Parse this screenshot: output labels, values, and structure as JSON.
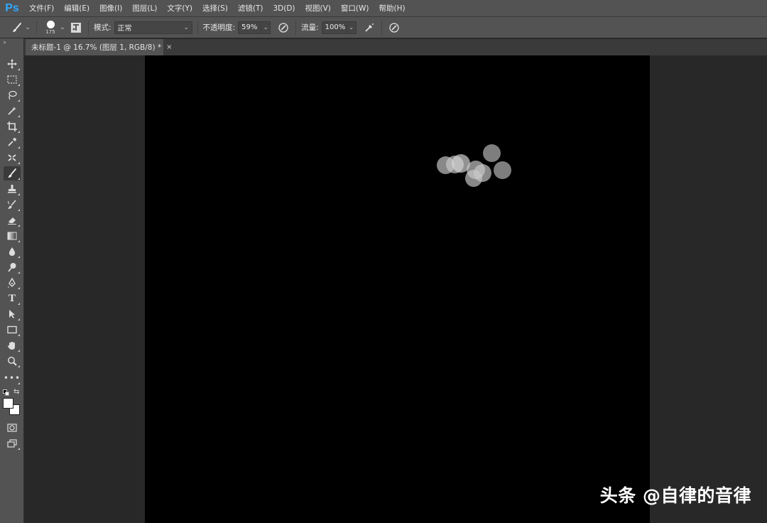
{
  "app": {
    "logo": "Ps"
  },
  "menu": {
    "items": [
      "文件(F)",
      "编辑(E)",
      "图像(I)",
      "图层(L)",
      "文字(Y)",
      "选择(S)",
      "滤镜(T)",
      "3D(D)",
      "视图(V)",
      "窗口(W)",
      "帮助(H)"
    ]
  },
  "options": {
    "brush_size": "175",
    "mode_label": "模式:",
    "mode_value": "正常",
    "opacity_label": "不透明度:",
    "opacity_value": "59%",
    "flow_label": "流量:",
    "flow_value": "100%"
  },
  "document": {
    "tab_title": "未标题-1 @ 16.7% (图层 1, RGB/8) *",
    "close_glyph": "×"
  },
  "tools": [
    "move-tool",
    "marquee-tool",
    "lasso-tool",
    "magic-wand-tool",
    "crop-tool",
    "eyedropper-tool",
    "healing-tool",
    "brush-tool",
    "stamp-tool",
    "history-brush-tool",
    "eraser-tool",
    "gradient-tool",
    "blur-tool",
    "dodge-tool",
    "pen-tool",
    "type-tool",
    "path-select-tool",
    "rectangle-tool",
    "hand-tool",
    "zoom-tool",
    "more-tools"
  ],
  "active_tool": "brush-tool",
  "colors": {
    "foreground": "#ffffff",
    "background": "#ffffff",
    "canvas": "#000000",
    "ps_blue": "#31a8ff"
  },
  "watermark": "头条 @自律的音律"
}
